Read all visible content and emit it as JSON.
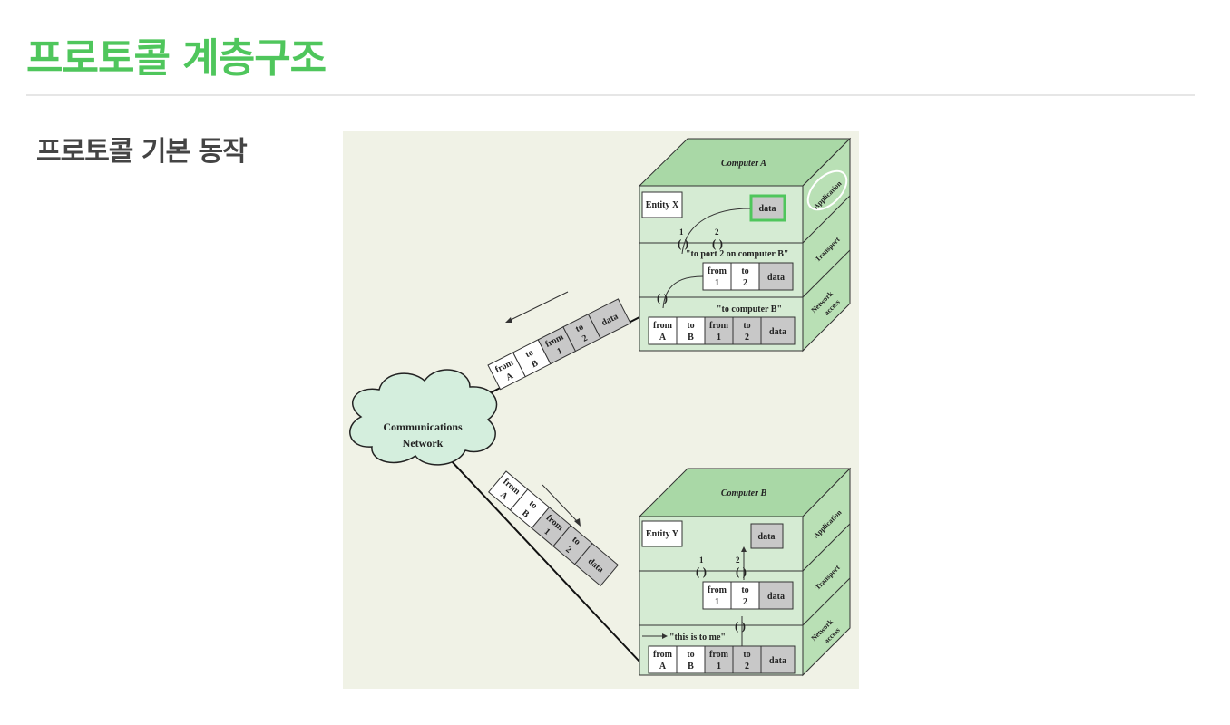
{
  "header": {
    "title": "프로토콜 계층구조"
  },
  "section": {
    "subtitle": "프로토콜 기본 동작"
  },
  "diagram": {
    "network_label": [
      "Communications",
      "Network"
    ],
    "computer_a": {
      "label": "Computer A",
      "entity": "Entity X",
      "data": "data",
      "layers": [
        "Application",
        "Transport",
        "Network",
        "access"
      ],
      "port_1": "1",
      "port_2": "2",
      "note_transport": "\"to port 2 on computer B\"",
      "note_network": "\"to computer B\""
    },
    "computer_b": {
      "label": "Computer B",
      "entity": "Entity Y",
      "data": "data",
      "layers": [
        "Application",
        "Transport",
        "Network",
        "access"
      ],
      "port_1": "1",
      "port_2": "2",
      "note_network": "\"this is to me\""
    },
    "transport_packet": [
      {
        "top": "from",
        "bottom": "1",
        "shaded": false
      },
      {
        "top": "to",
        "bottom": "2",
        "shaded": false
      },
      {
        "top": "data",
        "bottom": "",
        "shaded": true
      }
    ],
    "network_packet": [
      {
        "top": "from",
        "bottom": "A",
        "shaded": false
      },
      {
        "top": "to",
        "bottom": "B",
        "shaded": false
      },
      {
        "top": "from",
        "bottom": "1",
        "shaded": true
      },
      {
        "top": "to",
        "bottom": "2",
        "shaded": true
      },
      {
        "top": "data",
        "bottom": "",
        "shaded": true
      }
    ],
    "colors": {
      "cube_front": "#d5ebd3",
      "cube_top": "#a9d8a6",
      "cube_side": "#b9e0b5",
      "highlight": "#4fc65c",
      "shaded": "#c8c8c8",
      "cloud": "#d4eedd"
    }
  }
}
